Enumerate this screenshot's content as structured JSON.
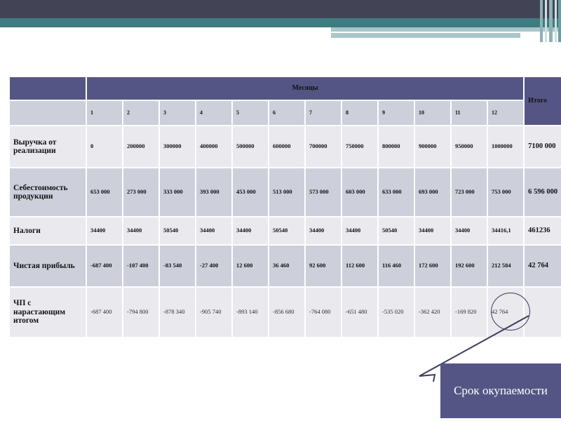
{
  "banner": {
    "name": "decorative-top-banner",
    "colors": {
      "dark": "#434356",
      "teal": "#3d7c80",
      "light_teal": "#a9c6ca"
    }
  },
  "theme": {
    "header_purple": "#555585",
    "row_light": "#e9e9ee",
    "row_dark": "#cdcfdb",
    "callout_fill": "#555585",
    "ellipse_stroke": "#3c3c5e"
  },
  "table": {
    "group_header": "Месяцы",
    "total_header": "Итого",
    "month_numbers": [
      "1",
      "2",
      "3",
      "4",
      "5",
      "6",
      "7",
      "8",
      "9",
      "10",
      "11",
      "12"
    ],
    "rows": [
      {
        "label": "Выручка от реализации",
        "values": [
          "0",
          "200000",
          "300000",
          "400000",
          "500000",
          "600000",
          "700000",
          "750000",
          "800000",
          "900000",
          "950000",
          "1000000"
        ],
        "total": "7100 000"
      },
      {
        "label": "Себестоимость продукции",
        "values": [
          "653 000",
          "273 000",
          "333 000",
          "393 000",
          "453 000",
          "513 000",
          "573 000",
          "603 000",
          "633 000",
          "693 000",
          "723 000",
          "753 000"
        ],
        "total": "6 596 000"
      },
      {
        "label": "Налоги",
        "values": [
          "34400",
          "34400",
          "50540",
          "34400",
          "34400",
          "50540",
          "34400",
          "34400",
          "50540",
          "34400",
          "34400",
          "34416,1"
        ],
        "total": "461236"
      },
      {
        "label": "Чистая прибыль",
        "values": [
          "-687 400",
          "-107 400",
          "-83 540",
          "-27 400",
          "12 600",
          "36 460",
          "92 600",
          "112 600",
          "116 460",
          "172 600",
          "192 600",
          "212 584"
        ],
        "total": "42 764"
      },
      {
        "label": "ЧП с нарастающим итогом",
        "values": [
          "-687 400",
          "-794 800",
          "-878 340",
          "-905 740",
          "-893 140",
          "-856 680",
          "-764 080",
          "-651 480",
          "-535 020",
          "-362 420",
          "-169 820",
          "42 764"
        ],
        "total": ""
      }
    ]
  },
  "callout": {
    "text": "Срок окупаемости",
    "highlighted_value": "42 764"
  }
}
